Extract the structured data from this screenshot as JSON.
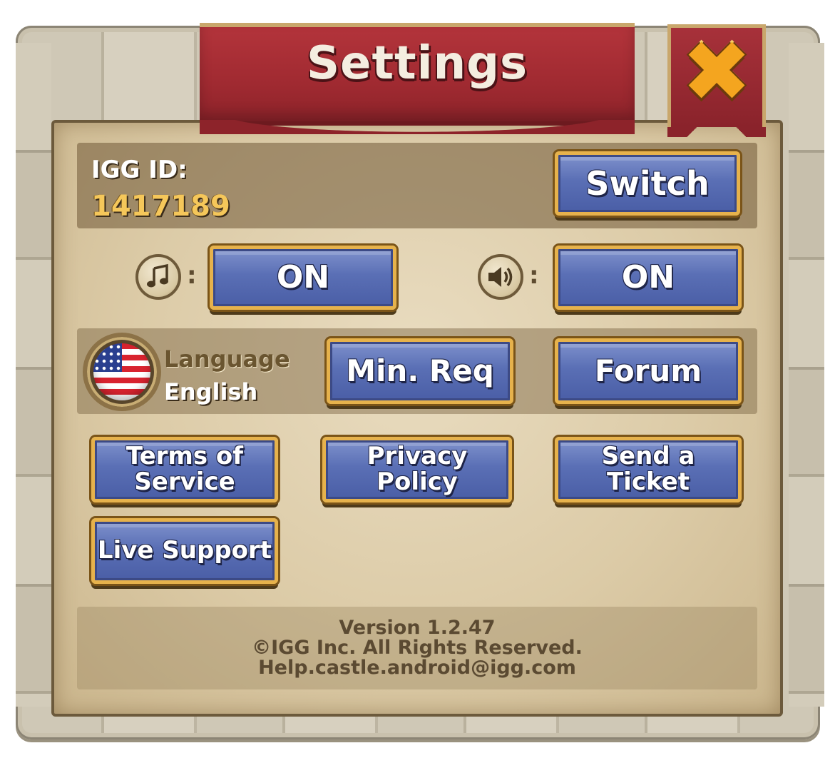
{
  "window": {
    "title": "Settings",
    "close_icon": "close-x-icon"
  },
  "account": {
    "id_label": "IGG ID:",
    "id_value": "1417189",
    "switch_label": "Switch"
  },
  "audio": {
    "music_icon": "music-note-icon",
    "music_state": "ON",
    "sound_icon": "speaker-icon",
    "sound_state": "ON",
    "separator": ":"
  },
  "language": {
    "flag_icon": "us-flag-icon",
    "label": "Language",
    "value": "English"
  },
  "buttons": {
    "min_req": "Min. Req",
    "forum": "Forum",
    "terms": "Terms of Service",
    "privacy": "Privacy Policy",
    "ticket": "Send a Ticket",
    "live_support": "Live Support"
  },
  "footer": {
    "version": "Version 1.2.47",
    "copyright": "©IGG Inc. All Rights Reserved.",
    "email": "Help.castle.android@igg.com"
  },
  "colors": {
    "banner": "#a02a31",
    "button_blue": "#5a6fb5",
    "button_border": "#e6b24c",
    "id_value": "#f5c75a",
    "close_x": "#f4a51f"
  }
}
